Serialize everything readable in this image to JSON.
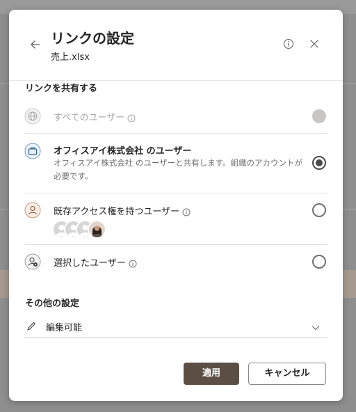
{
  "dialog": {
    "title": "リンクの設定",
    "subtitle": "売上.xlsx"
  },
  "share_section": {
    "heading": "リンクを共有する",
    "options": [
      {
        "label": "すべてのユーザー",
        "icon": "globe-icon",
        "state": "disabled"
      },
      {
        "label": "オフィスアイ株式会社 のユーザー",
        "description": "オフィスアイ株式会社 のユーザーと共有します。組織のアカウントが必要です。",
        "icon": "briefcase-icon",
        "state": "selected"
      },
      {
        "label": "既存アクセス権を持つユーザー",
        "icon": "person-icon",
        "state": "unselected"
      },
      {
        "label": "選択したユーザー",
        "icon": "person-settings-icon",
        "state": "unselected"
      }
    ]
  },
  "other_section": {
    "heading": "その他の設定",
    "permission": "編集可能"
  },
  "buttons": {
    "apply": "適用",
    "cancel": "キャンセル"
  },
  "colors": {
    "primary_button": "#5b4e44",
    "radio_selected": "#4a4a4a",
    "disabled_text": "#a7a7a7"
  }
}
